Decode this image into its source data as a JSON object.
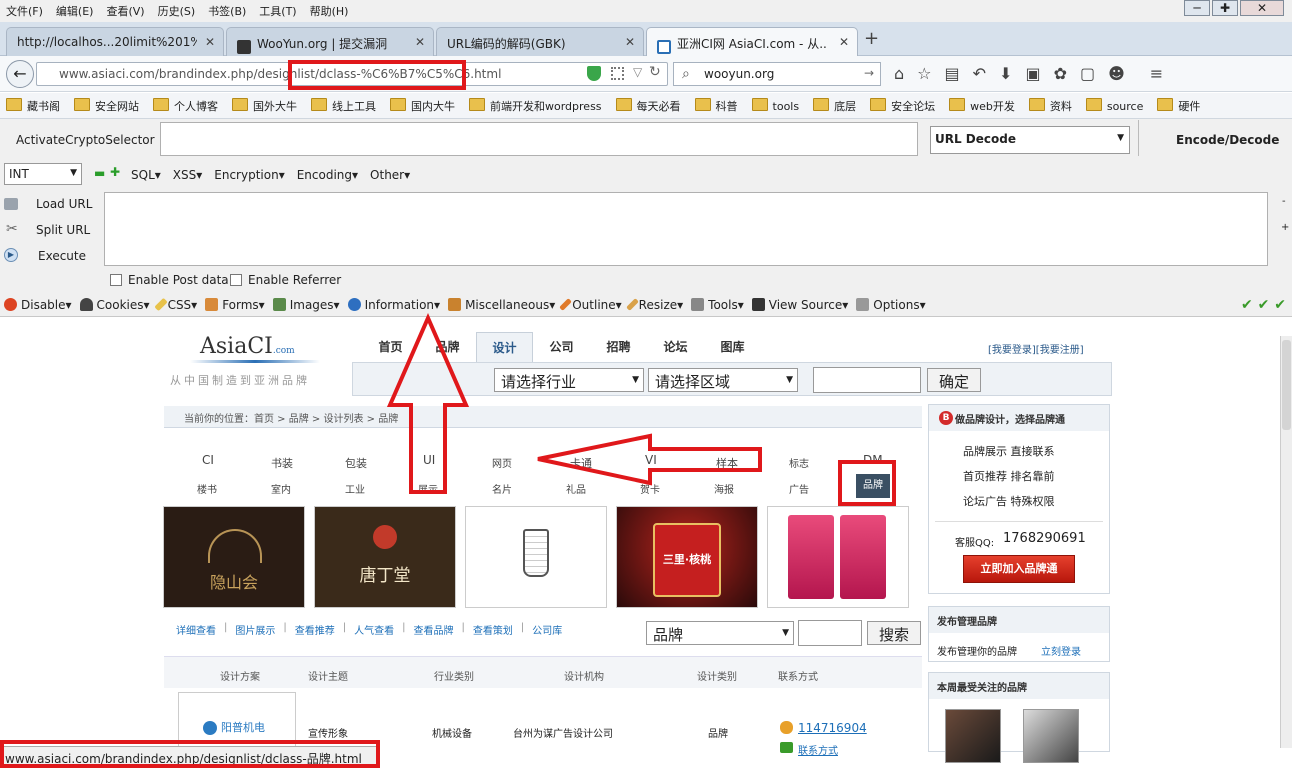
{
  "menubar": {
    "items": [
      "文件(F)",
      "编辑(E)",
      "查看(V)",
      "历史(S)",
      "书签(B)",
      "工具(T)",
      "帮助(H)"
    ]
  },
  "window_controls": [
    "─",
    "✚",
    "✕"
  ],
  "tabs": [
    {
      "label": "http://localhos...20limit%201%23",
      "active": false
    },
    {
      "label": "WooYun.org | 提交漏洞",
      "active": false
    },
    {
      "label": "URL编码的解码(GBK)",
      "active": false
    },
    {
      "label": "亚洲CI网 AsiaCI.com - 从...",
      "active": true
    }
  ],
  "new_tab": "+",
  "urlbar": {
    "url_prefix": "www.asiaci.com/brandindex.php/designlist/",
    "url_highlight": "dclass-%C6%B7%C5%C6.html"
  },
  "searchbar": {
    "value": "wooyun.org"
  },
  "bookmarks": [
    "藏书阁",
    "安全网站",
    "个人博客",
    "国外大牛",
    "线上工具",
    "国内大牛",
    "前端开发和wordpress",
    "每天必看",
    "科普",
    "tools",
    "底层",
    "安全论坛",
    "web开发",
    "资料",
    "source",
    "硬件"
  ],
  "hackbar": {
    "crypto_selector": "ActivateCryptoSelector",
    "decode_select": "URL Decode",
    "encode_decode": "Encode/Decode",
    "int_select": "INT",
    "menus": [
      "SQL▾",
      "XSS▾",
      "Encryption▾",
      "Encoding▾",
      "Other▾"
    ],
    "load_url": "Load URL",
    "split_url": "Split URL",
    "execute": "Execute",
    "enable_post": "Enable Post data",
    "enable_referrer": "Enable Referrer"
  },
  "webdev": [
    "Disable▾",
    "Cookies▾",
    "CSS▾",
    "Forms▾",
    "Images▾",
    "Information▾",
    "Miscellaneous▾",
    "Outline▾",
    "Resize▾",
    "Tools▾",
    "View Source▾",
    "Options▾"
  ],
  "site": {
    "logo": "AsiaCI",
    "logo_com": ".com",
    "logo_sub": "从中国制造到亚洲品牌",
    "nav": [
      "首页",
      "品牌",
      "设计",
      "公司",
      "招聘",
      "论坛",
      "图库"
    ],
    "login": "[我要登录][我要注册]",
    "industry": "请选择行业",
    "region": "请选择区域",
    "confirm": "确定",
    "breadcrumb": "当前你的位置：首页 > 品牌 > 设计列表 > 品牌",
    "cats_row1": [
      "CI",
      "书装",
      "包装",
      "UI",
      "网页",
      "卡通",
      "VI",
      "样本",
      "标志",
      "DM"
    ],
    "cats_row2": [
      "楼书",
      "室内",
      "工业",
      "展示",
      "名片",
      "礼品",
      "贺卡",
      "海报",
      "广告",
      "品牌"
    ],
    "filters": [
      "详细查看",
      "图片展示",
      "查看推荐",
      "人气查看",
      "查看品牌",
      "查看策划",
      "公司库"
    ],
    "brand_select": "品牌",
    "search_btn": "搜索",
    "table_headers": [
      "设计方案",
      "设计主题",
      "行业类别",
      "设计机构",
      "设计类别",
      "联系方式"
    ],
    "row": {
      "theme": "宣传形象",
      "industry": "机械设备",
      "agency": "台州为谋广告设计公司",
      "type": "品牌",
      "qq": "114716904",
      "contact": "联系方式",
      "logo_text": "阳普机电"
    },
    "side1": {
      "title": "做品牌设计，选择品牌通",
      "lines": [
        "品牌展示 直接联系",
        "首页推荐 排名靠前",
        "论坛广告 特殊权限"
      ],
      "qq_label": "客服QQ:",
      "qq": "1768290691",
      "join": "立即加入品牌通"
    },
    "side2": {
      "title": "发布管理品牌",
      "text": "发布管理你的品牌",
      "link": "立刻登录"
    },
    "side3": {
      "title": "本周最受关注的品牌"
    },
    "thumb_texts": [
      "隐山会",
      "唐丁堂",
      "三里·核桃"
    ]
  },
  "statusbar": "www.asiaci.com/brandindex.php/designlist/dclass-品牌.html"
}
